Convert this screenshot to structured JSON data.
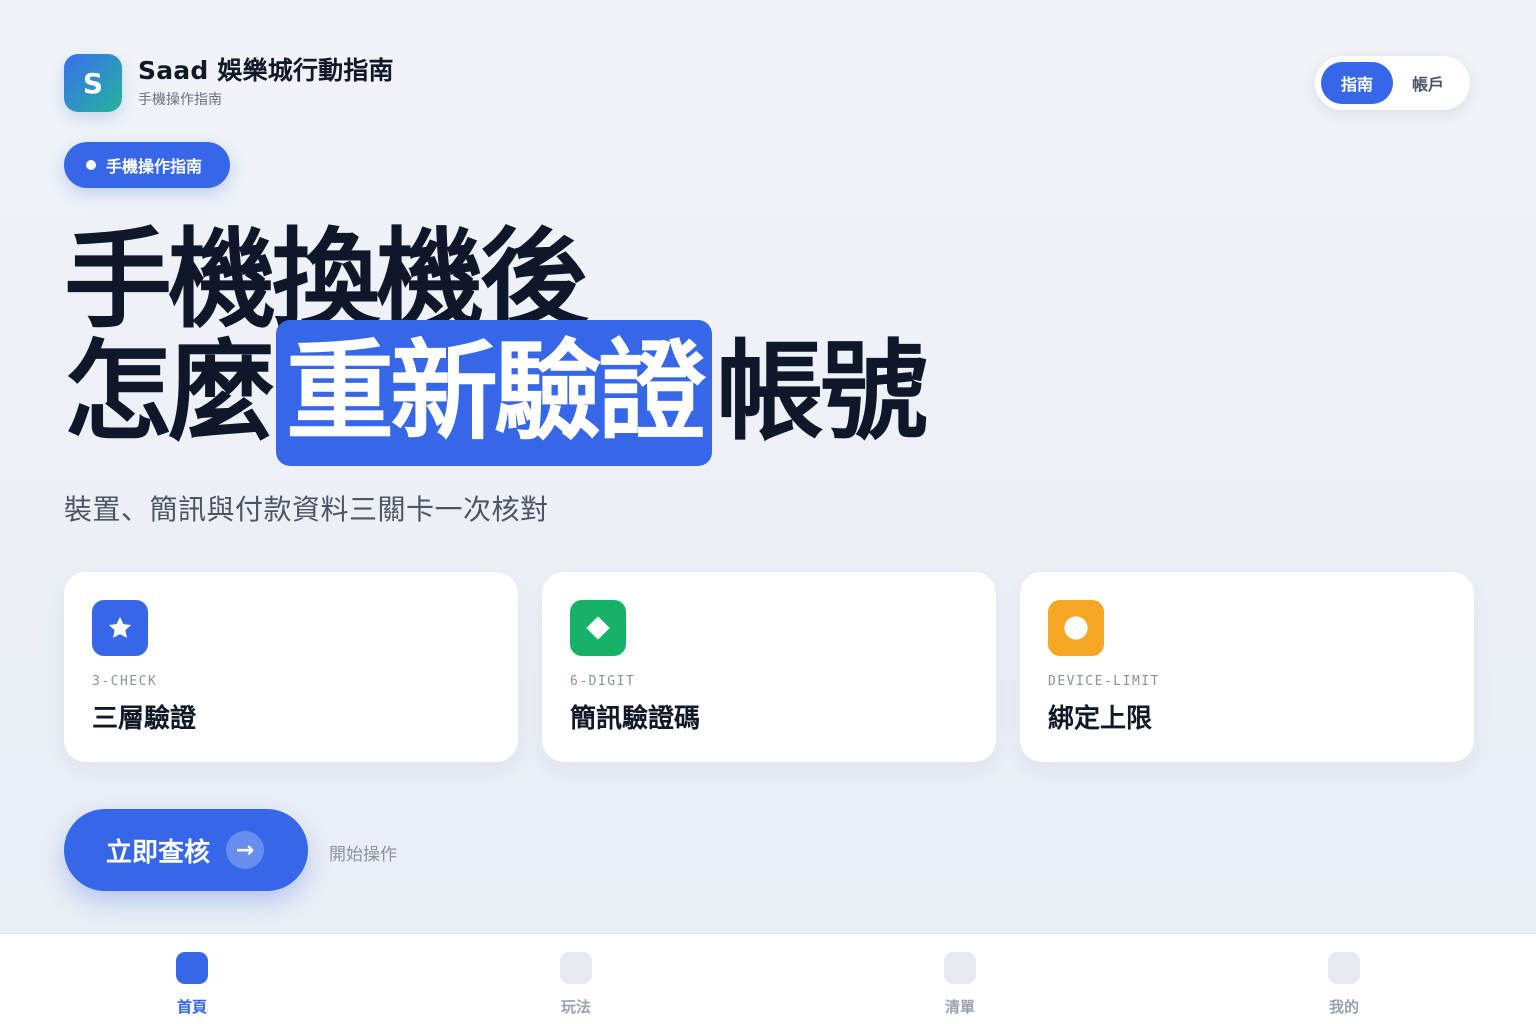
{
  "brand": {
    "logo_letter": "S",
    "title": "Saad 娛樂城行動指南",
    "subtitle": "手機操作指南"
  },
  "segmented": {
    "items": [
      {
        "label": "指南",
        "active": true
      },
      {
        "label": "帳戶",
        "active": false
      }
    ]
  },
  "pill": {
    "label": "手機操作指南"
  },
  "hero": {
    "line1": "手機換機後",
    "line2_before": "怎麼",
    "line2_highlight": "重新驗證",
    "line2_after": "帳號",
    "subtitle": "裝置、簡訊與付款資料三關卡一次核對"
  },
  "cards": [
    {
      "icon": "star-icon",
      "icon_color": "#3567e8",
      "code": "3-CHECK",
      "title": "三層驗證"
    },
    {
      "icon": "diamond-icon",
      "icon_color": "#16b26a",
      "code": "6-DIGIT",
      "title": "簡訊驗證碼"
    },
    {
      "icon": "circle-icon",
      "icon_color": "#f4a624",
      "code": "DEVICE-LIMIT",
      "title": "綁定上限"
    }
  ],
  "cta": {
    "label": "立即查核",
    "arrow": "→",
    "hint": "開始操作"
  },
  "tabbar": {
    "items": [
      {
        "label": "首頁",
        "active": true
      },
      {
        "label": "玩法",
        "active": false
      },
      {
        "label": "清單",
        "active": false
      },
      {
        "label": "我的",
        "active": false
      }
    ]
  },
  "colors": {
    "accent": "#3567e8",
    "text": "#0f172a"
  }
}
